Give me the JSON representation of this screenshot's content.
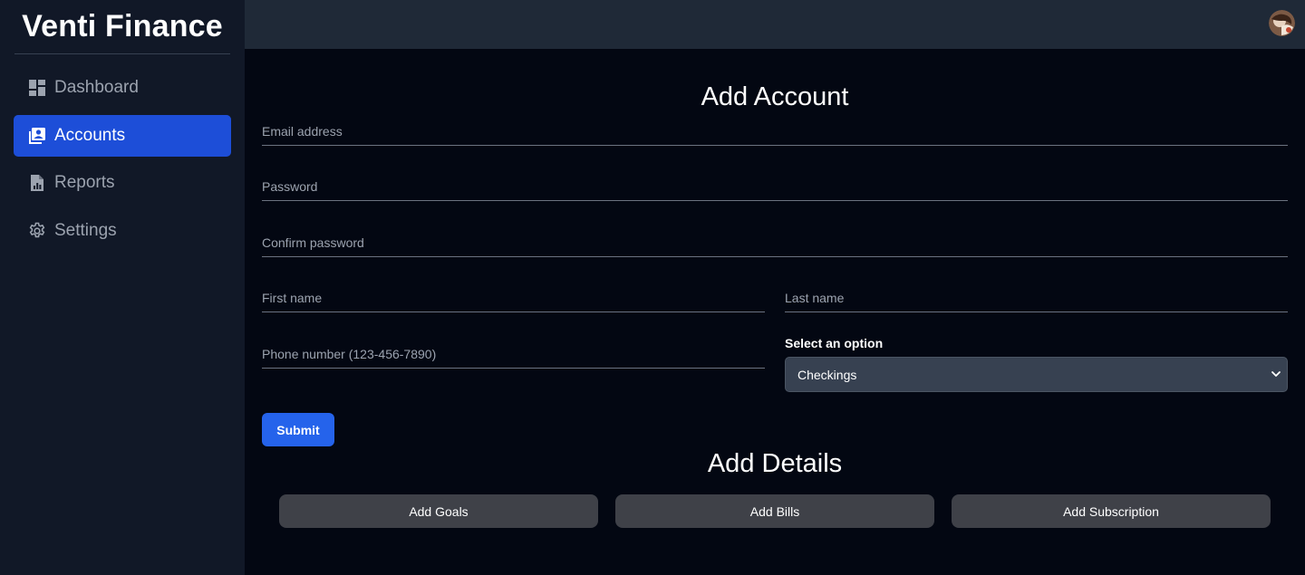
{
  "app": {
    "title": "Venti Finance"
  },
  "sidebar": {
    "items": [
      {
        "label": "Dashboard",
        "icon": "dashboard-icon",
        "active": false
      },
      {
        "label": "Accounts",
        "icon": "account-box-icon",
        "active": true
      },
      {
        "label": "Reports",
        "icon": "report-icon",
        "active": false
      },
      {
        "label": "Settings",
        "icon": "gear-icon",
        "active": false
      }
    ]
  },
  "topbar": {
    "avatar": "user-avatar"
  },
  "form": {
    "title": "Add Account",
    "email": {
      "placeholder": "Email address",
      "value": ""
    },
    "password": {
      "placeholder": "Password",
      "value": ""
    },
    "confirm_password": {
      "placeholder": "Confirm password",
      "value": ""
    },
    "first_name": {
      "placeholder": "First name",
      "value": ""
    },
    "last_name": {
      "placeholder": "Last name",
      "value": ""
    },
    "phone": {
      "placeholder": "Phone number (123-456-7890)",
      "value": ""
    },
    "select": {
      "label": "Select an option",
      "selected": "Checkings"
    },
    "submit_label": "Submit"
  },
  "details": {
    "title": "Add Details",
    "buttons": [
      "Add Goals",
      "Add Bills",
      "Add Subscription"
    ]
  },
  "colors": {
    "accent": "#1d4ed8",
    "submit": "#2563eb",
    "sidebar_bg": "#111827",
    "topbar_bg": "#1f2937",
    "main_bg": "#030712"
  }
}
